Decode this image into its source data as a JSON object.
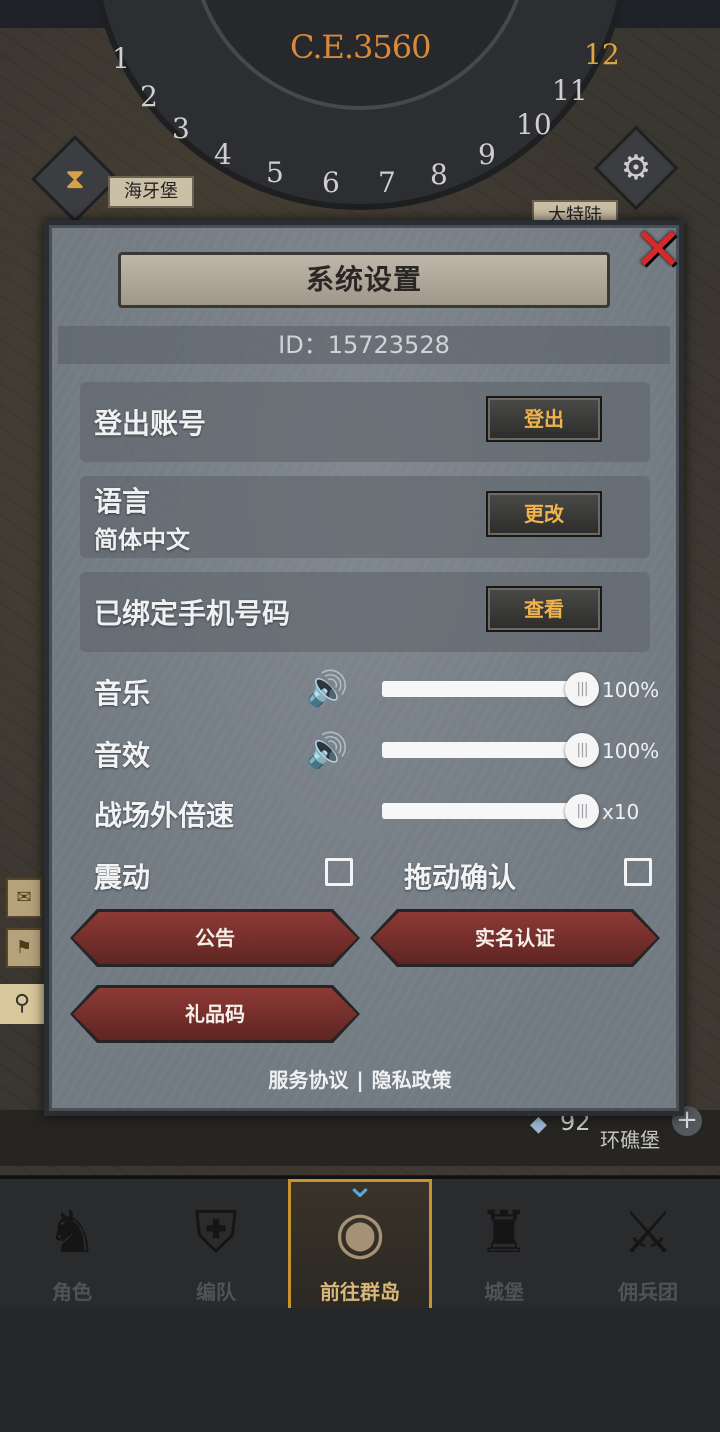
{
  "map": {
    "era": "C.E.3560",
    "dial_numbers": [
      "1",
      "2",
      "3",
      "4",
      "5",
      "6",
      "7",
      "8",
      "9",
      "10",
      "11",
      "12"
    ],
    "castle_left": "海牙堡",
    "castle_right": "大特陆",
    "castle_bottom": "环礁堡",
    "crystal_count": "92"
  },
  "panel": {
    "title": "系统设置",
    "id_text": "ID：15723528",
    "logout_label": "登出账号",
    "logout_button": "登出",
    "language_label": "语言",
    "language_value": "简体中文",
    "language_button": "更改",
    "phone_label": "已绑定手机号码",
    "phone_button": "查看",
    "music_label": "音乐",
    "music_value": "100%",
    "music_level": 1.0,
    "sfx_label": "音效",
    "sfx_value": "100%",
    "sfx_level": 1.0,
    "speed_label": "战场外倍速",
    "speed_value": "x10",
    "speed_level": 1.0,
    "vibrate_label": "震动",
    "vibrate_checked": false,
    "drag_confirm_label": "拖动确认",
    "drag_confirm_checked": false,
    "notice_button": "公告",
    "realname_button": "实名认证",
    "giftcode_button": "礼品码",
    "service_link": "服务协议",
    "separator": "|",
    "privacy_link": "隐私政策"
  },
  "nav": {
    "items": [
      {
        "label": "角色",
        "icon": "knight-icon"
      },
      {
        "label": "编队",
        "icon": "team-icon"
      },
      {
        "label": "前往群岛",
        "icon": "globe-icon"
      },
      {
        "label": "城堡",
        "icon": "castle-icon"
      },
      {
        "label": "佣兵团",
        "icon": "mercenary-icon"
      }
    ],
    "active_index": 2
  }
}
